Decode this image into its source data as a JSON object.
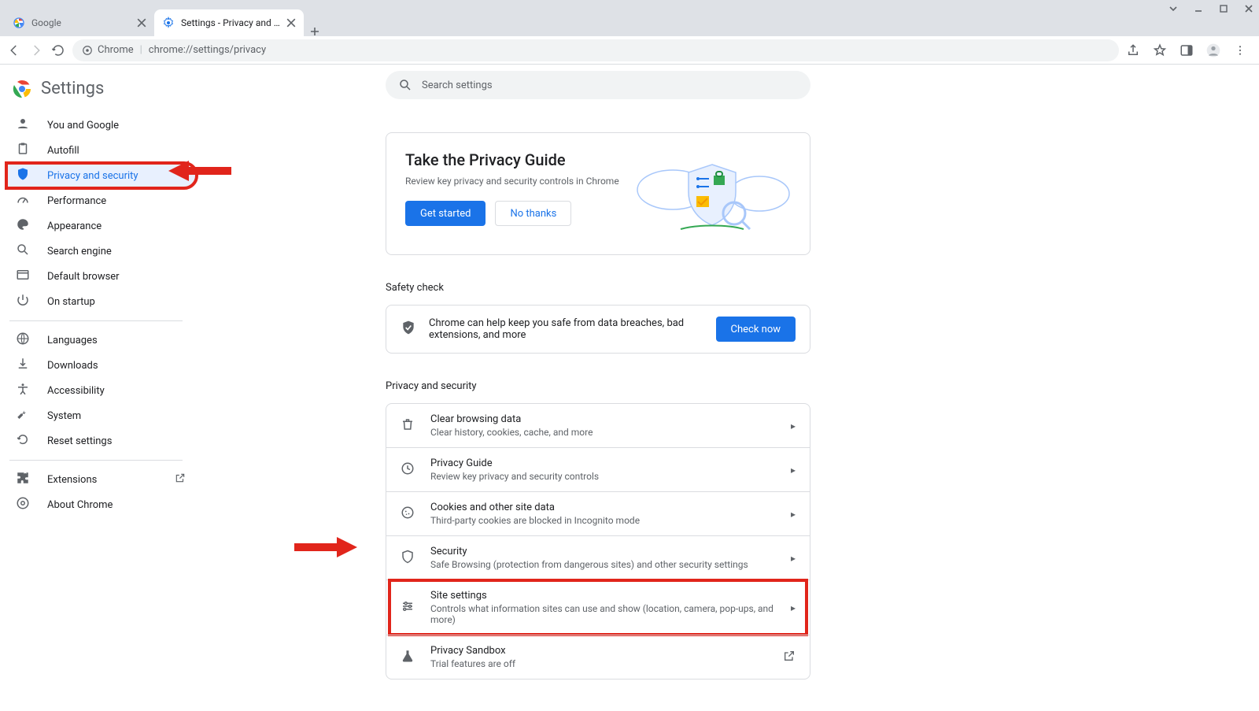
{
  "window": {
    "tabs": [
      {
        "label": "Google",
        "active": false
      },
      {
        "label": "Settings - Privacy and security",
        "active": true
      }
    ]
  },
  "toolbar": {
    "scheme_label": "Chrome",
    "url": "chrome://settings/privacy"
  },
  "sidebar": {
    "title": "Settings",
    "items": [
      {
        "label": "You and Google"
      },
      {
        "label": "Autofill"
      },
      {
        "label": "Privacy and security"
      },
      {
        "label": "Performance"
      },
      {
        "label": "Appearance"
      },
      {
        "label": "Search engine"
      },
      {
        "label": "Default browser"
      },
      {
        "label": "On startup"
      }
    ],
    "items2": [
      {
        "label": "Languages"
      },
      {
        "label": "Downloads"
      },
      {
        "label": "Accessibility"
      },
      {
        "label": "System"
      },
      {
        "label": "Reset settings"
      }
    ],
    "items3": [
      {
        "label": "Extensions"
      },
      {
        "label": "About Chrome"
      }
    ]
  },
  "search": {
    "placeholder": "Search settings"
  },
  "guide": {
    "title": "Take the Privacy Guide",
    "subtitle": "Review key privacy and security controls in Chrome",
    "primary": "Get started",
    "secondary": "No thanks"
  },
  "safety": {
    "heading": "Safety check",
    "message": "Chrome can help keep you safe from data breaches, bad extensions, and more",
    "button": "Check now"
  },
  "privacy": {
    "heading": "Privacy and security",
    "rows": [
      {
        "title": "Clear browsing data",
        "sub": "Clear history, cookies, cache, and more"
      },
      {
        "title": "Privacy Guide",
        "sub": "Review key privacy and security controls"
      },
      {
        "title": "Cookies and other site data",
        "sub": "Third-party cookies are blocked in Incognito mode"
      },
      {
        "title": "Security",
        "sub": "Safe Browsing (protection from dangerous sites) and other security settings"
      },
      {
        "title": "Site settings",
        "sub": "Controls what information sites can use and show (location, camera, pop-ups, and more)"
      },
      {
        "title": "Privacy Sandbox",
        "sub": "Trial features are off"
      }
    ]
  }
}
